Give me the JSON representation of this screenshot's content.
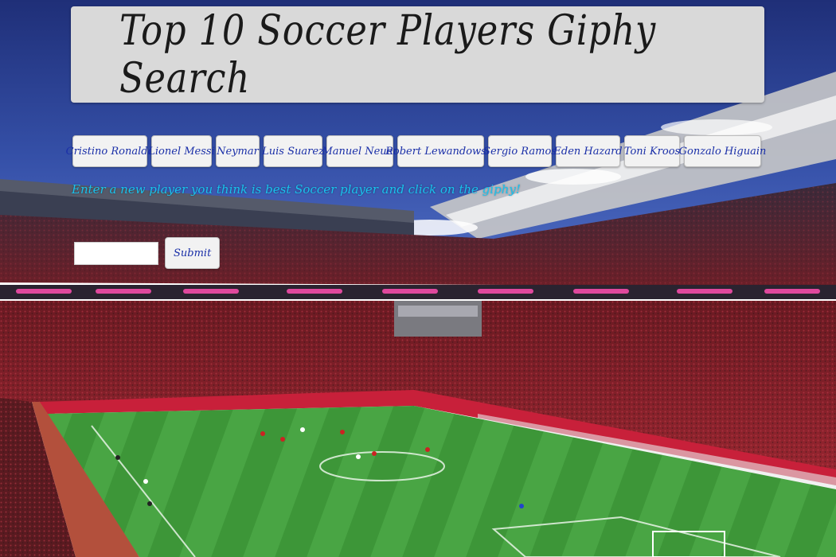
{
  "header": {
    "title": "Top 10 Soccer Players Giphy Search"
  },
  "players": [
    "Cristino Ronaldo",
    "Lionel Messi",
    "Neymar",
    "Luis Suarez",
    "Manuel Neuer",
    "Robert Lewandowski",
    "Sergio Ramos",
    "Eden Hazard",
    "Toni Kroos",
    "Gonzalo Higuain"
  ],
  "instruction": "Enter a new player you think is best Soccer player and click on the giphy!",
  "form": {
    "input_value": "",
    "submit_label": "Submit"
  },
  "background": {
    "subject": "soccer-stadium-photo"
  },
  "colors": {
    "header_bg": "#d9d9d9",
    "button_bg": "#f2f2f2",
    "button_text": "#1a2fa8",
    "instruction_text": "#19c2ee",
    "sky": "#2a3f8f",
    "pitch": "#3f9a3a",
    "crowd": "#8a1e24"
  }
}
